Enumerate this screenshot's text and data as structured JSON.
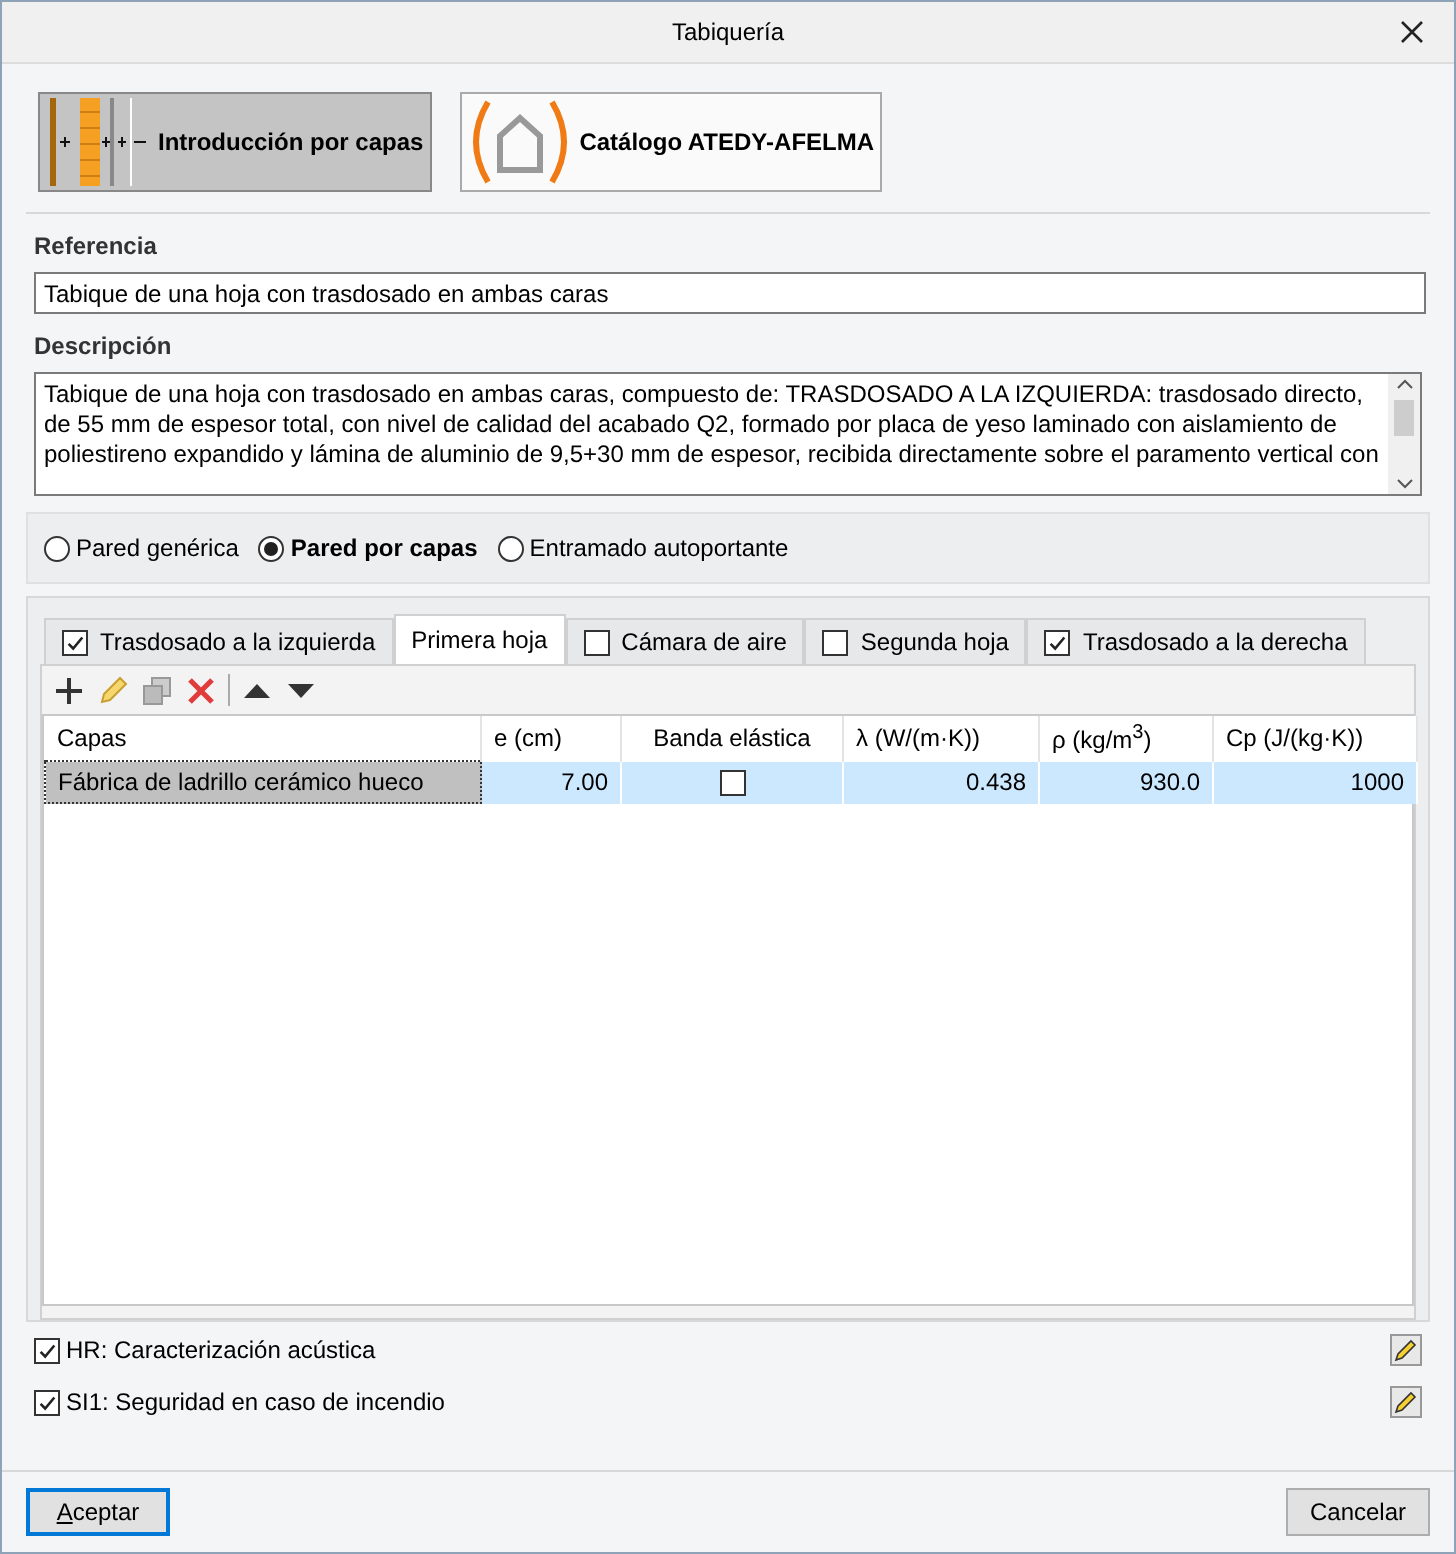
{
  "window": {
    "title": "Tabiquería"
  },
  "mode_buttons": [
    {
      "label": "Introducción por capas",
      "kind": "layers",
      "selected": true
    },
    {
      "label": "Catálogo ATEDY-AFELMA",
      "kind": "catalog",
      "selected": false
    }
  ],
  "reference": {
    "label": "Referencia",
    "value": "Tabique de una hoja con trasdosado en ambas caras"
  },
  "description": {
    "label": "Descripción",
    "value": "Tabique de una hoja con trasdosado en ambas caras, compuesto de: TRASDOSADO A LA IZQUIERDA: trasdosado directo, de 55 mm de espesor total, con nivel de calidad del acabado Q2, formado por placa de yeso laminado con aislamiento de poliestireno expandido y lámina de aluminio de 9,5+30 mm de espesor, recibida directamente sobre el paramento vertical con"
  },
  "wall_types": [
    {
      "label": "Pared genérica",
      "selected": false
    },
    {
      "label": "Pared por capas",
      "selected": true
    },
    {
      "label": "Entramado autoportante",
      "selected": false
    }
  ],
  "tabs": [
    {
      "label": "Trasdosado a la izquierda",
      "kind": "check",
      "checked": true,
      "selected": false
    },
    {
      "label": "Primera hoja",
      "kind": "plain",
      "selected": true
    },
    {
      "label": "Cámara de aire",
      "kind": "check",
      "checked": false,
      "selected": false
    },
    {
      "label": "Segunda hoja",
      "kind": "check",
      "checked": false,
      "selected": false
    },
    {
      "label": "Trasdosado a la derecha",
      "kind": "check",
      "checked": true,
      "selected": false
    }
  ],
  "table": {
    "columns": [
      {
        "label": "Capas",
        "kind": "text"
      },
      {
        "label": "e (cm)",
        "kind": "number"
      },
      {
        "label": "Banda elástica",
        "kind": "check"
      },
      {
        "label": "λ (W/(m·K))",
        "kind": "number"
      },
      {
        "label": "ρ (kg/m$^{3}$)",
        "kind": "number"
      },
      {
        "label": "Cp (J/(kg·K))",
        "kind": "number"
      }
    ],
    "rows": [
      {
        "selected": true,
        "cells": [
          "Fábrica de ladrillo cerámico hueco",
          "7.00",
          false,
          "0.438",
          "930.0",
          "1000"
        ]
      }
    ]
  },
  "options": [
    {
      "label": "HR: Caracterización acústica",
      "checked": true
    },
    {
      "label": "SI1: Seguridad en caso de incendio",
      "checked": true
    }
  ],
  "buttons": [
    {
      "label": "Aceptar",
      "kind": "default"
    },
    {
      "label": "Cancelar",
      "kind": "normal"
    }
  ]
}
